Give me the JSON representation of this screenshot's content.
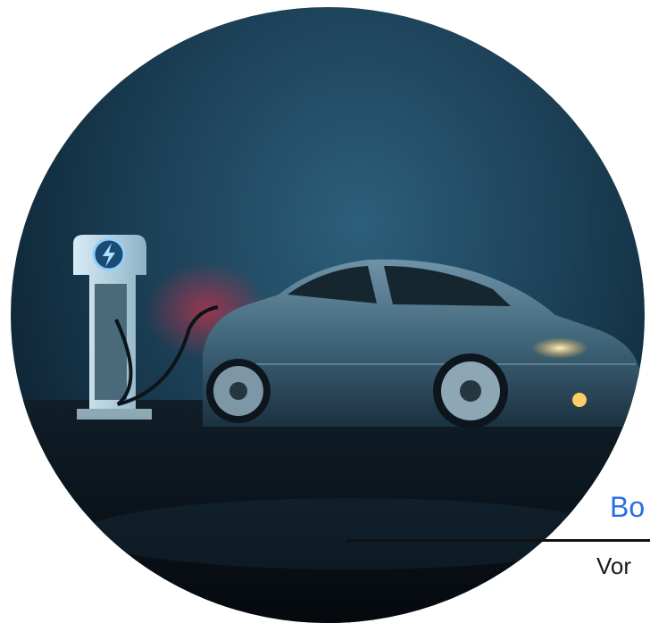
{
  "hero": {
    "image": "ev-charging-car-photo",
    "charger_icon": "lightning-bolt-icon"
  },
  "caption": {
    "title": "Bo",
    "subtitle": "Vor"
  },
  "colors": {
    "accent": "#2a6fe0",
    "text": "#1a1a1a",
    "divider": "#111111",
    "scene_dark": "#0f2738",
    "scene_light": "#2c5f7a"
  }
}
